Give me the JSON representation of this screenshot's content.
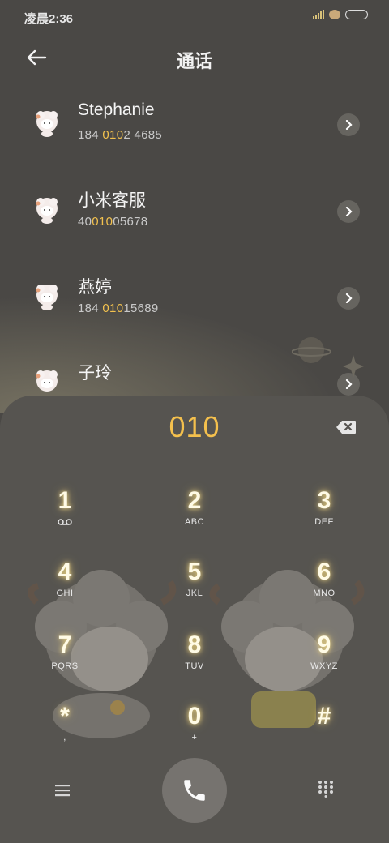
{
  "status_bar": {
    "time": "凌晨2:36"
  },
  "header": {
    "title": "通话"
  },
  "contacts": [
    {
      "name": "Stephanie",
      "number_pre": "184 ",
      "number_hl": "010",
      "number_post": "2 4685"
    },
    {
      "name": "小米客服",
      "number_pre": "40",
      "number_hl": "010",
      "number_post": "05678"
    },
    {
      "name": "燕婷",
      "number_pre": "184 ",
      "number_hl": "010",
      "number_post": "15689"
    },
    {
      "name": "子玲",
      "number_pre": "",
      "number_hl": "",
      "number_post": ""
    }
  ],
  "dialer": {
    "input": "010",
    "keys": [
      {
        "num": "1",
        "sub": "voicemail-icon"
      },
      {
        "num": "2",
        "sub": "ABC"
      },
      {
        "num": "3",
        "sub": "DEF"
      },
      {
        "num": "4",
        "sub": "GHI"
      },
      {
        "num": "5",
        "sub": "JKL"
      },
      {
        "num": "6",
        "sub": "MNO"
      },
      {
        "num": "7",
        "sub": "PQRS"
      },
      {
        "num": "8",
        "sub": "TUV"
      },
      {
        "num": "9",
        "sub": "WXYZ"
      },
      {
        "num": "*",
        "sub": ","
      },
      {
        "num": "0",
        "sub": "+"
      },
      {
        "num": "#",
        "sub": ""
      }
    ]
  },
  "colors": {
    "accent": "#f2c14e",
    "background": "#4a4845",
    "panel": "#565450"
  }
}
